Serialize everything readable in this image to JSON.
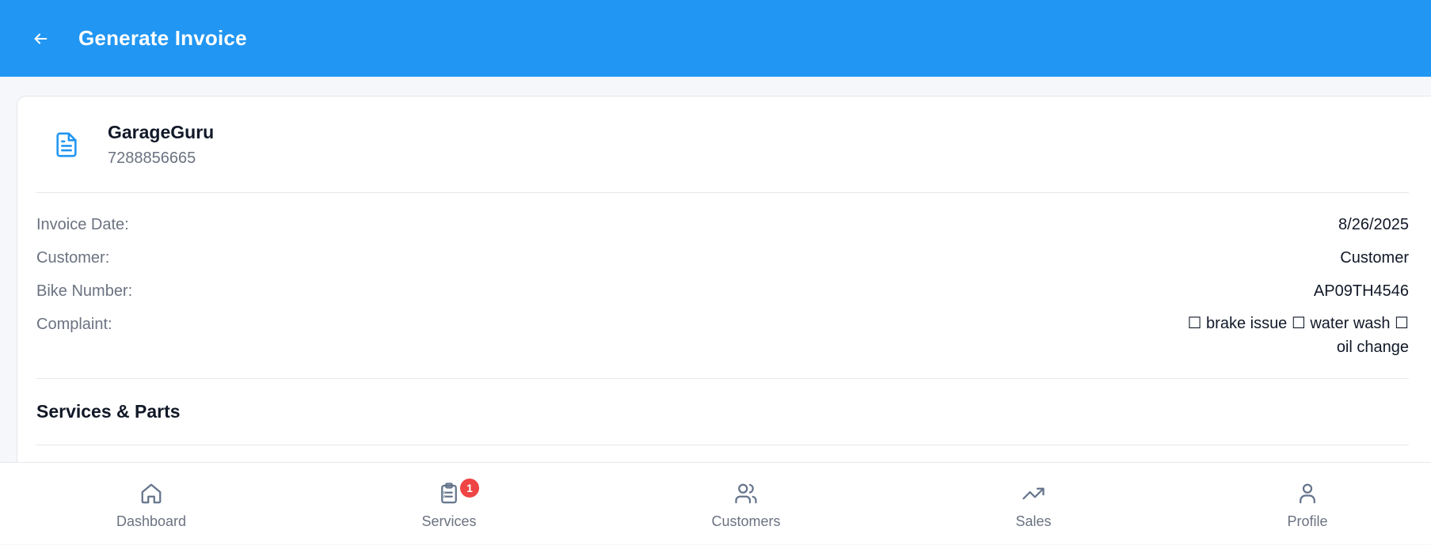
{
  "header": {
    "title": "Generate Invoice",
    "back_icon": "arrow-left-icon",
    "background_color": "#2196f3"
  },
  "business": {
    "name": "GarageGuru",
    "phone": "7288856665",
    "icon": "document-icon"
  },
  "details": {
    "invoice_date_label": "Invoice Date:",
    "invoice_date_value": "8/26/2025",
    "customer_label": "Customer:",
    "customer_value": "Customer",
    "bike_number_label": "Bike Number:",
    "bike_number_value": "AP09TH4546",
    "complaint_label": "Complaint:",
    "complaint_value": "☐ brake issue ☐ water wash ☐ oil change"
  },
  "sections": {
    "services_parts": "Services & Parts"
  },
  "bottom_nav": {
    "dashboard": "Dashboard",
    "services": "Services",
    "services_badge": "1",
    "customers": "Customers",
    "sales": "Sales",
    "profile": "Profile"
  },
  "colors": {
    "accent": "#2196f3",
    "badge": "#ef4444",
    "muted_text": "#6b7280",
    "nav_icon": "#64748b"
  }
}
